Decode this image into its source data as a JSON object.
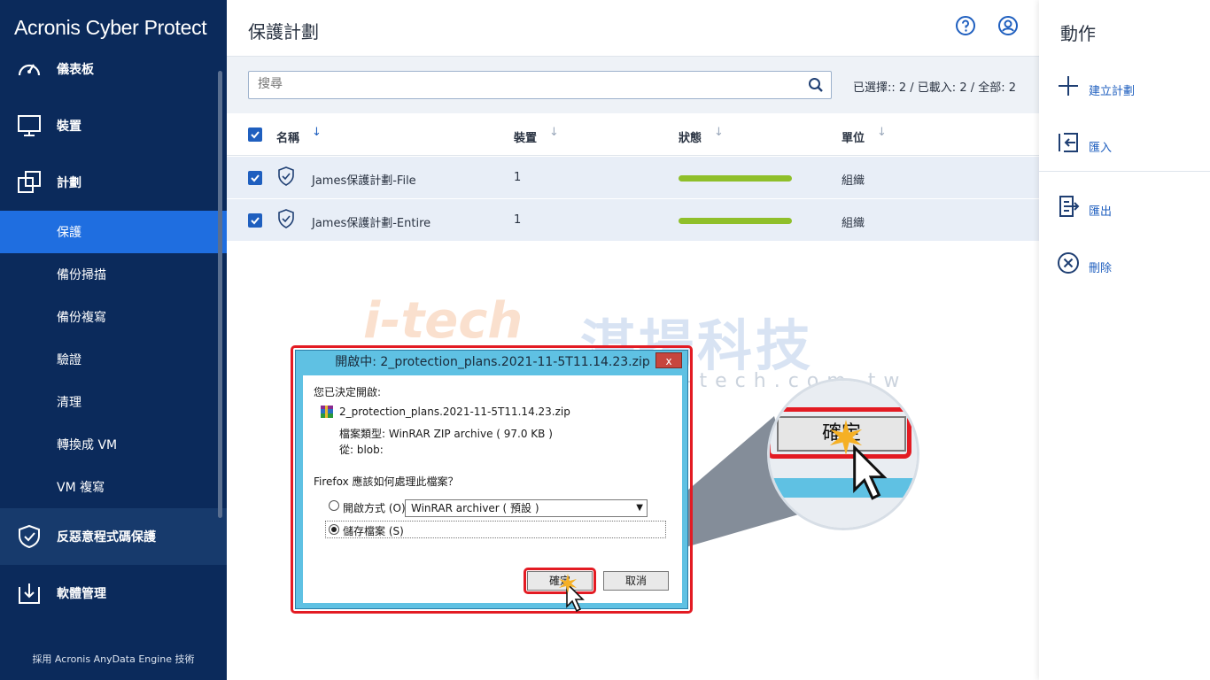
{
  "sidebar": {
    "brand": "Acronis Cyber Protect",
    "items": [
      {
        "label": "儀表板",
        "icon": "dashboard-icon"
      },
      {
        "label": "裝置",
        "icon": "monitor-icon"
      },
      {
        "label": "計劃",
        "icon": "plans-icon"
      }
    ],
    "sub_items": [
      "保護",
      "備份掃描",
      "備份複寫",
      "驗證",
      "清理",
      "轉換成 VM",
      "VM 複寫"
    ],
    "active_sub": "保護",
    "items_bottom": [
      {
        "label": "反惡意程式碼保護",
        "icon": "shield-icon"
      },
      {
        "label": "軟體管理",
        "icon": "software-download-icon"
      }
    ],
    "footer": "採用 Acronis AnyData Engine 技術"
  },
  "header": {
    "title": "保護計劃",
    "icons": [
      "help-icon",
      "account-icon"
    ]
  },
  "toolbar": {
    "search_placeholder": "搜尋",
    "selection_summary": "已選擇:: 2 / 已載入: 2 / 全部: 2"
  },
  "table": {
    "columns": [
      "名稱",
      "裝置",
      "狀態",
      "單位"
    ],
    "rows": [
      {
        "name": "James保護計劃-File",
        "devices": "1",
        "status_progress": 1.0,
        "unit": "組織"
      },
      {
        "name": "James保護計劃-Entire",
        "devices": "1",
        "status_progress": 1.0,
        "unit": "組織"
      }
    ]
  },
  "actions": {
    "title": "動作",
    "items": [
      {
        "label": "建立計劃",
        "icon": "plus-icon"
      },
      {
        "label": "匯入",
        "icon": "import-icon"
      },
      {
        "label": "匯出",
        "icon": "export-icon"
      },
      {
        "label": "刪除",
        "icon": "delete-icon"
      }
    ]
  },
  "watermark": {
    "logo": "i-tech",
    "title": "湛揚科技",
    "url": "www.t-tech.com.tw"
  },
  "dialog": {
    "title": "開啟中: 2_protection_plans.2021-11-5T11.14.23.zip",
    "close": "x",
    "intro": "您已決定開啟:",
    "filename": "2_protection_plans.2021-11-5T11.14.23.zip",
    "file_type": "檔案類型:  WinRAR ZIP archive ( 97.0 KB )",
    "from": "從:  blob:",
    "question": "Firefox 應該如何處理此檔案？",
    "open_with_label": "開啟方式 (O):",
    "open_with_value": "WinRAR archiver ( 預設 )",
    "save_label": "儲存檔案 (S)",
    "ok": "確定",
    "cancel": "取消",
    "zoom_ok": "確定"
  },
  "colors": {
    "sidebar_bg": "#0b2a5b",
    "active_item": "#1f6ee0",
    "accent": "#1f5fbf",
    "status_ok": "#8fbf2a",
    "highlight": "#e31b23"
  }
}
